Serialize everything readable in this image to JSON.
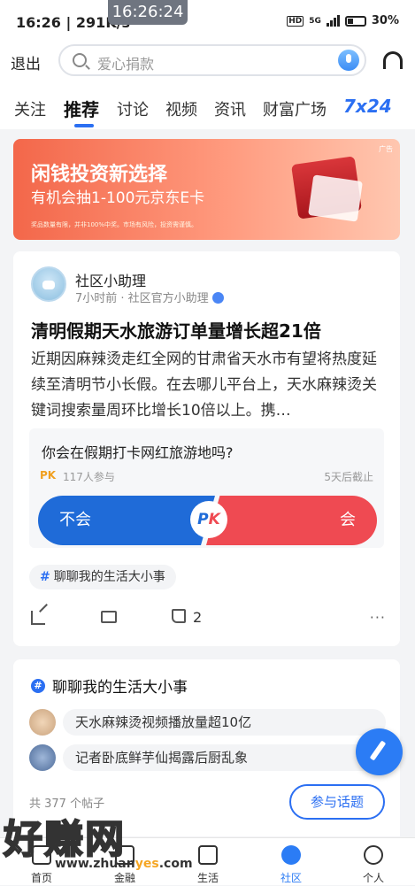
{
  "status_bar": {
    "time": "16:26 | 291K/s",
    "clock_overlay": "16:26:24",
    "network": "5G",
    "battery": "30%"
  },
  "topbar": {
    "exit_label": "退出",
    "search_placeholder": "爱心捐款"
  },
  "tabs": [
    {
      "label": "关注"
    },
    {
      "label": "推荐",
      "active": true
    },
    {
      "label": "讨论"
    },
    {
      "label": "视频"
    },
    {
      "label": "资讯"
    },
    {
      "label": "财富广场"
    },
    {
      "label": "7x24"
    }
  ],
  "banner": {
    "title": "闲钱投资新选择",
    "subtitle": "有机会抽1-100元京东E卡",
    "fineprint": "奖品数量有限，并非100%中奖。市场有风险，投资需谨慎。",
    "ad_label": "广告"
  },
  "post": {
    "author": "社区小助理",
    "meta": "7小时前 · 社区官方小助理",
    "title": "清明假期天水旅游订单量增长超21倍",
    "body": "近期因麻辣烫走红全网的甘肃省天水市有望将热度延续至清明节小长假。在去哪儿平台上，天水麻辣烫关键词搜索量周环比增长10倍以上。携…",
    "poll": {
      "question": "你会在假期打卡网红旅游地吗?",
      "pk_label": "PK",
      "participants": "117人参与",
      "deadline": "5天后截止",
      "option_no": "不会",
      "option_yes": "会",
      "pk_p": "P",
      "pk_k": "K"
    },
    "topic_tag": "聊聊我的生活大小事",
    "like_count": "2",
    "more": "···"
  },
  "topic_card": {
    "title": "聊聊我的生活大小事",
    "items": [
      {
        "text": "天水麻辣烫视频播放量超10亿"
      },
      {
        "text": "记者卧底鲜芋仙揭露后厨乱象"
      }
    ],
    "post_count": "共 377 个帖子",
    "join_label": "参与话题"
  },
  "watermark": {
    "text": "好赚网",
    "url_a": "www.zhuan",
    "url_b": "yes",
    "url_c": ".com"
  },
  "bottom_nav": [
    {
      "label": "首页"
    },
    {
      "label": "金融"
    },
    {
      "label": "生活"
    },
    {
      "label": "社区",
      "active": true
    },
    {
      "label": "个人"
    }
  ],
  "colors": {
    "accent": "#2b6ff2",
    "poll_no": "#1f6bd8",
    "poll_yes": "#ef4a52",
    "banner": "#f3674a"
  }
}
